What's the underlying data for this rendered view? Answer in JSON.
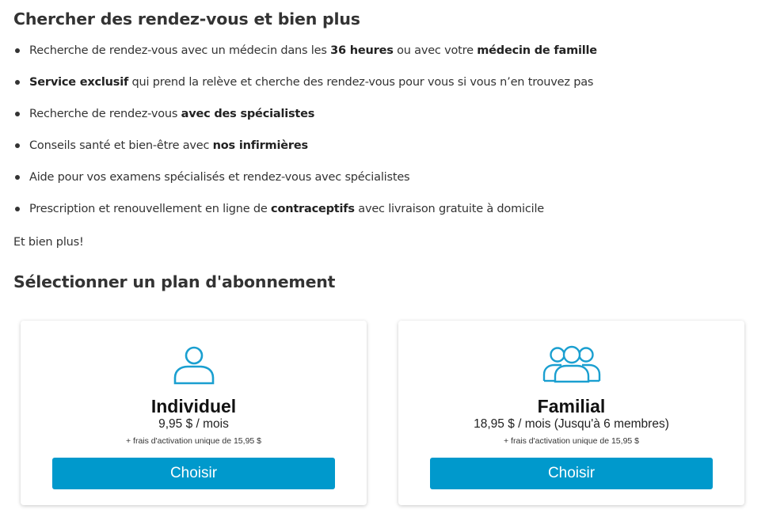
{
  "section1": {
    "title": "Chercher des rendez-vous et bien plus",
    "features": [
      [
        {
          "t": "Recherche de rendez-vous avec un médecin dans les ",
          "b": false
        },
        {
          "t": "36 heures",
          "b": true
        },
        {
          "t": " ou avec votre ",
          "b": false
        },
        {
          "t": "médecin de famille",
          "b": true
        }
      ],
      [
        {
          "t": "Service exclusif",
          "b": true
        },
        {
          "t": " qui prend la relève et cherche des rendez-vous pour vous si vous n’en trouvez pas",
          "b": false
        }
      ],
      [
        {
          "t": "Recherche de rendez-vous ",
          "b": false
        },
        {
          "t": "avec des spécialistes",
          "b": true
        }
      ],
      [
        {
          "t": "Conseils santé et bien-être avec ",
          "b": false
        },
        {
          "t": "nos infirmières",
          "b": true
        }
      ],
      [
        {
          "t": "Aide pour vos examens spécialisés et rendez-vous avec spécialistes",
          "b": false
        }
      ],
      [
        {
          "t": "Prescription et renouvellement en ligne de ",
          "b": false
        },
        {
          "t": "contraceptifs",
          "b": true
        },
        {
          "t": " avec livraison gratuite à domicile",
          "b": false
        }
      ]
    ],
    "more": "Et bien plus!"
  },
  "section2": {
    "title": "Sélectionner un plan d'abonnement"
  },
  "plans": [
    {
      "name": "Individuel",
      "price": "9,95 $ / mois",
      "fee": "+ frais d'activation unique de 15,95 $",
      "button": "Choisir",
      "icon": "person-icon"
    },
    {
      "name": "Familial",
      "price": "18,95 $ / mois (Jusqu'à 6 membres)",
      "fee": "+ frais d'activation unique de 15,95 $",
      "button": "Choisir",
      "icon": "group-icon"
    }
  ],
  "colors": {
    "accent": "#0099cc",
    "icon": "#1a9fd0",
    "text": "#333333"
  }
}
